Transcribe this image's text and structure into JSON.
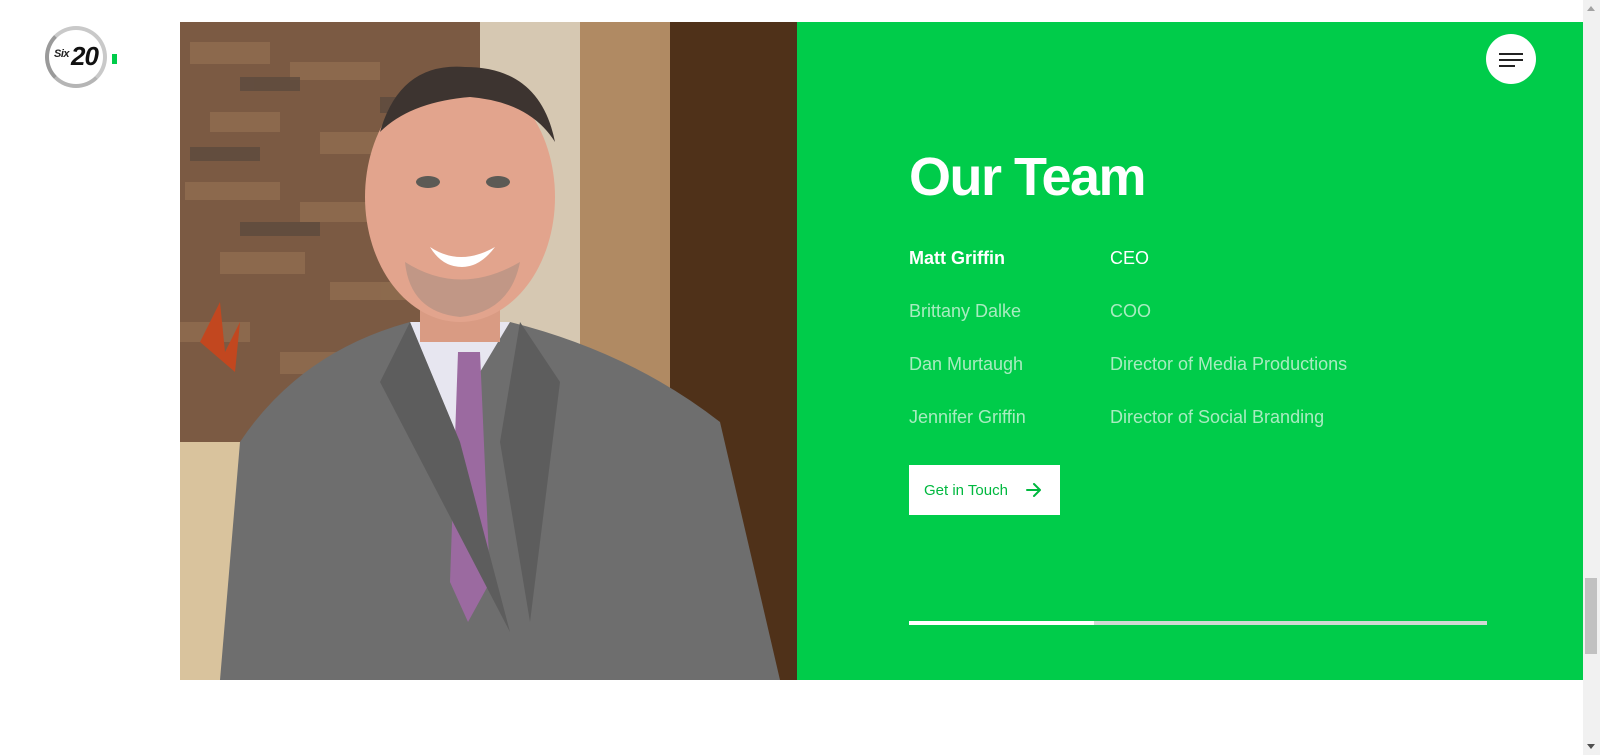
{
  "header": {
    "logo": {
      "prefix": "Six",
      "number": "20",
      "accent_color": "#00cc4a"
    },
    "menu_icon": "hamburger-menu-icon"
  },
  "team": {
    "heading": "Our Team",
    "members": [
      {
        "name": "Matt Griffin",
        "role": "CEO",
        "active": true
      },
      {
        "name": "Brittany Dalke",
        "role": "COO",
        "active": false
      },
      {
        "name": "Dan Murtaugh",
        "role": "Director of Media Productions",
        "active": false
      },
      {
        "name": "Jennifer Griffin",
        "role": "Director of Social Branding",
        "active": false
      }
    ],
    "cta_label": "Get in Touch",
    "cta_icon": "arrow-right-icon",
    "progress": 0.32,
    "panel_color": "#00cc4a",
    "inactive_text_color": "#a8ecc0"
  }
}
